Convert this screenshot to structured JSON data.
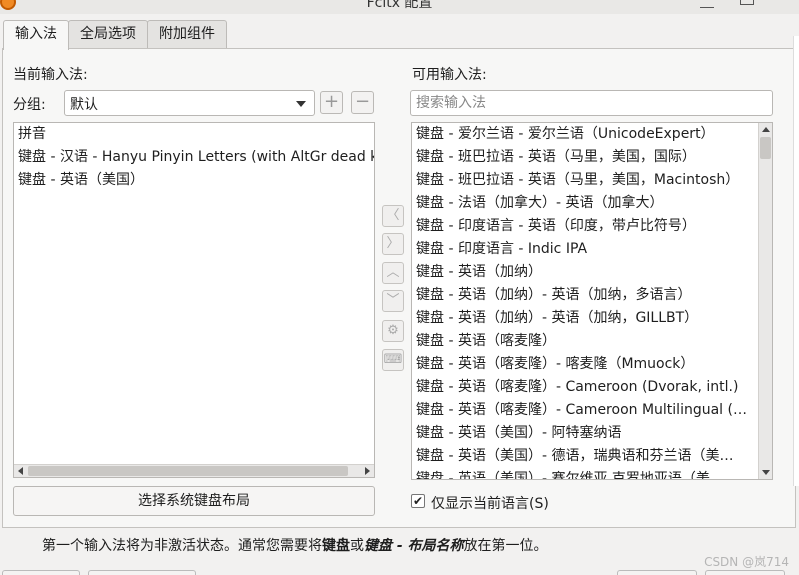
{
  "window": {
    "title": "Fcitx 配置"
  },
  "tabs": [
    {
      "label": "输入法",
      "active": true
    },
    {
      "label": "全局选项",
      "active": false
    },
    {
      "label": "附加组件",
      "active": false
    }
  ],
  "left": {
    "heading": "当前输入法:",
    "group_label": "分组:",
    "group_value": "默认",
    "add_glyph": "+",
    "remove_glyph": "−",
    "items": [
      "拼音",
      "键盘 - 汉语 - Hanyu Pinyin Letters (with AltGr dead key",
      "键盘 - 英语（美国）"
    ],
    "select_layout_button": "选择系统键盘布局"
  },
  "right": {
    "heading": "可用输入法:",
    "search_placeholder": "搜索输入法",
    "items": [
      "键盘 - 爱尔兰语 - 爱尔兰语（UnicodeExpert）",
      "键盘 - 班巴拉语 - 英语（马里，美国，国际）",
      "键盘 - 班巴拉语 - 英语（马里，美国，Macintosh）",
      "键盘 - 法语（加拿大）- 英语（加拿大）",
      "键盘 - 印度语言 - 英语（印度，带卢比符号）",
      "键盘 - 印度语言 - Indic IPA",
      "键盘 - 英语（加纳）",
      "键盘 - 英语（加纳）- 英语（加纳，多语言）",
      "键盘 - 英语（加纳）- 英语（加纳，GILLBT）",
      "键盘 - 英语（喀麦隆）",
      "键盘 - 英语（喀麦隆）- 喀麦隆（Mmuock）",
      "键盘 - 英语（喀麦隆）- Cameroon (Dvorak, intl.)",
      "键盘 - 英语（喀麦隆）- Cameroon Multilingual (…",
      "键盘 - 英语（美国）- 阿特塞纳语",
      "键盘 - 英语（美国）- 德语，瑞典语和芬兰语（美…",
      "键盘 - 英语（美国）- 赛尔维亚 克罗地亚语（美…"
    ],
    "only_current_language": "仅显示当前语言(S)",
    "only_current_checked": true
  },
  "middle_buttons": [
    {
      "name": "move-left-icon",
      "glyph": "〈"
    },
    {
      "name": "move-right-icon",
      "glyph": "〉"
    },
    {
      "name": "move-up-icon",
      "glyph": "︿"
    },
    {
      "name": "move-down-icon",
      "glyph": "﹀"
    },
    {
      "name": "configure-gear-icon",
      "glyph": "⚙"
    },
    {
      "name": "keyboard-icon",
      "glyph": "⌨"
    }
  ],
  "hint": {
    "p1": "第一个输入法将为非激活状态。通常您需要将",
    "b1": "键盘",
    "p2": "或",
    "b2": "键盘 - 布局名称",
    "p3": "放在第一位。"
  },
  "watermark": "CSDN @岚714"
}
